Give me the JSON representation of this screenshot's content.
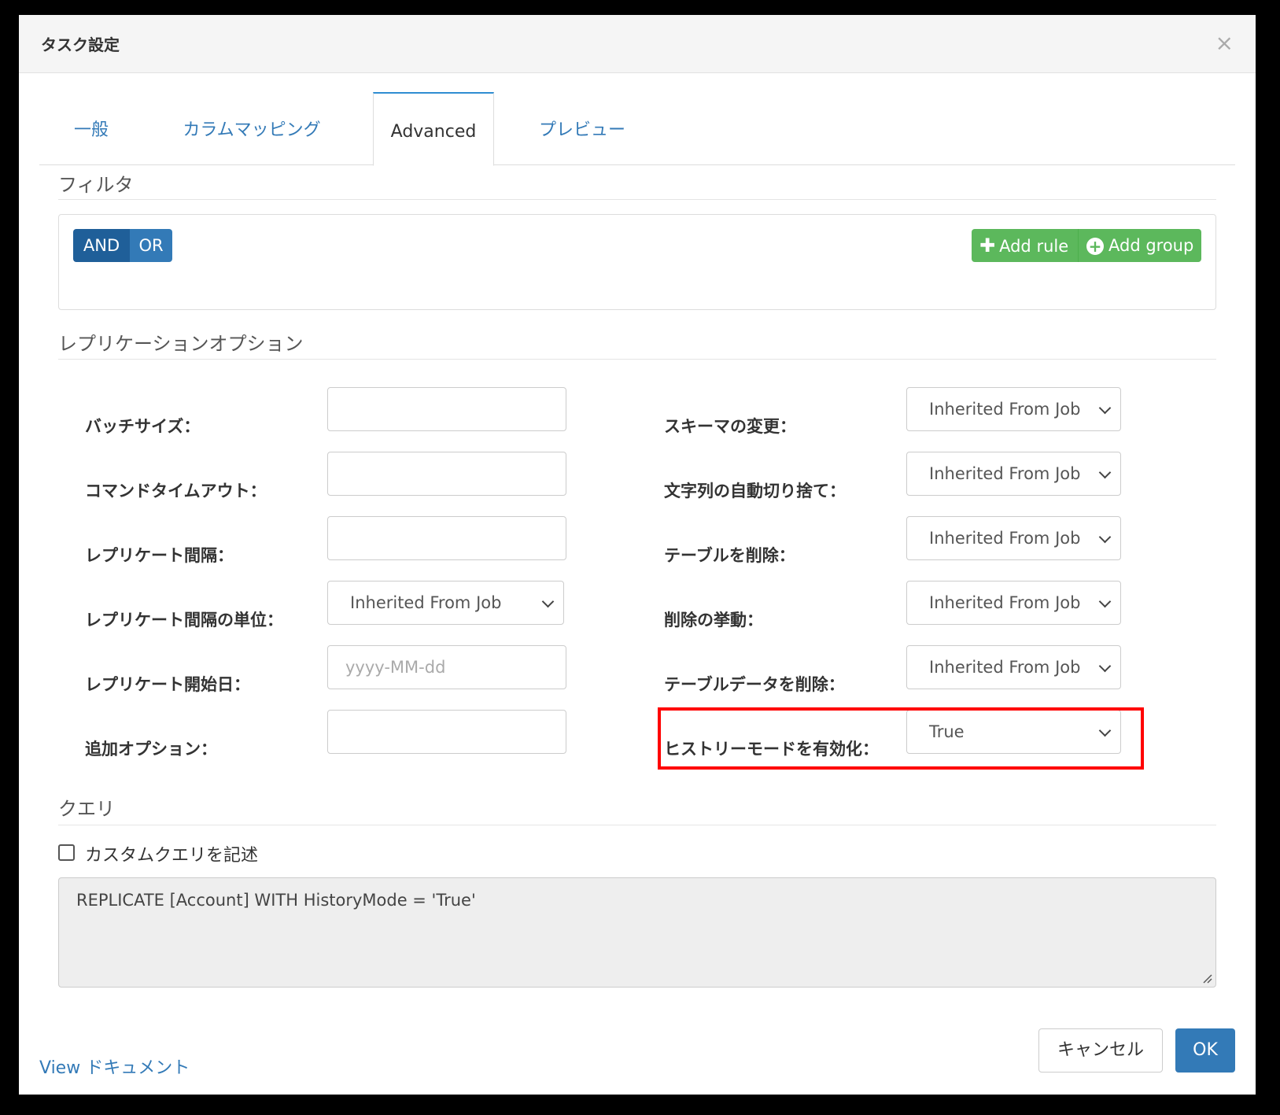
{
  "dialog": {
    "title": "タスク設定",
    "close_glyph": "×"
  },
  "tabs": [
    {
      "label": "一般"
    },
    {
      "label": "カラムマッピング"
    },
    {
      "label": "Advanced"
    },
    {
      "label": "プレビュー"
    }
  ],
  "filter": {
    "title": "フィルタ",
    "and_label": "AND",
    "or_label": "OR",
    "add_rule_label": "Add rule",
    "add_group_label": "Add group"
  },
  "replication": {
    "title": "レプリケーションオプション",
    "left": [
      {
        "label": "バッチサイズ：",
        "value": ""
      },
      {
        "label": "コマンドタイムアウト：",
        "value": ""
      },
      {
        "label": "レプリケート間隔：",
        "value": ""
      },
      {
        "label": "レプリケート間隔の単位：",
        "value": "Inherited From Job"
      },
      {
        "label": "レプリケート開始日：",
        "placeholder": "yyyy-MM-dd"
      },
      {
        "label": "追加オプション：",
        "value": ""
      }
    ],
    "right": [
      {
        "label": "スキーマの変更：",
        "value": "Inherited From Job"
      },
      {
        "label": "文字列の自動切り捨て：",
        "value": "Inherited From Job"
      },
      {
        "label": "テーブルを削除：",
        "value": "Inherited From Job"
      },
      {
        "label": "削除の挙動：",
        "value": "Inherited From Job"
      },
      {
        "label": "テーブルデータを削除：",
        "value": "Inherited From Job"
      },
      {
        "label": "ヒストリーモードを有効化：",
        "value": "True"
      }
    ]
  },
  "query": {
    "title": "クエリ",
    "custom_query_label": "カスタムクエリを記述",
    "custom_query_checked": false,
    "text": "REPLICATE [Account] WITH HistoryMode = 'True'"
  },
  "footer": {
    "view_doc_label": "View ドキュメント",
    "cancel_label": "キャンセル",
    "ok_label": "OK"
  },
  "colors": {
    "accent": "#337ab7",
    "green": "#5cb85c",
    "highlight": "#ff0000"
  }
}
